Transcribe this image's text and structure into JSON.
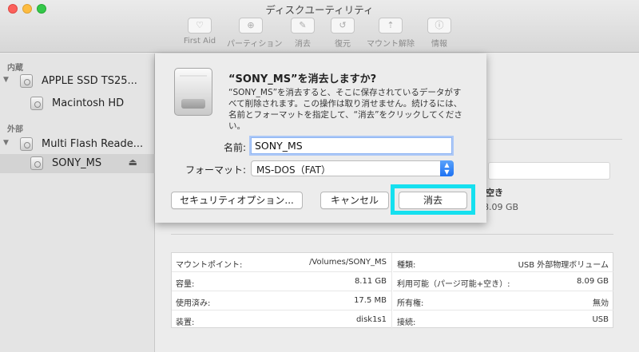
{
  "window": {
    "title": "ディスクユーティリティ"
  },
  "toolbar": {
    "buttons": [
      {
        "label": "First Aid",
        "icon": "stethoscope-icon"
      },
      {
        "label": "パーティション",
        "icon": "pie-icon"
      },
      {
        "label": "消去",
        "icon": "erase-icon"
      },
      {
        "label": "復元",
        "icon": "restore-icon"
      },
      {
        "label": "マウント解除",
        "icon": "unmount-icon"
      },
      {
        "label": "情報",
        "icon": "info-icon"
      }
    ]
  },
  "sidebar": {
    "internal_header": "内蔵",
    "external_header": "外部",
    "items": [
      {
        "label": "APPLE SSD TS25..."
      },
      {
        "label": "Macintosh HD"
      },
      {
        "label": "Multi Flash Reade..."
      },
      {
        "label": "SONY_MS"
      }
    ]
  },
  "dialog": {
    "title": "“SONY_MS”を消去しますか?",
    "description": "“SONY_MS”を消去すると、そこに保存されているデータがすべて削除されます。この操作は取り消せません。続けるには、名前とフォーマットを指定して、“消去”をクリックしてください。",
    "name_label": "名前:",
    "name_value": "SONY_MS",
    "format_label": "フォーマット:",
    "format_value": "MS-DOS（FAT）",
    "security_button": "セキュリティオプション...",
    "cancel_button": "キャンセル",
    "erase_button": "消去"
  },
  "summary": {
    "free_label": "空き",
    "free_value": "8.09 GB"
  },
  "info": {
    "left": [
      {
        "key": "マウントポイント:",
        "value": "/Volumes/SONY_MS"
      },
      {
        "key": "容量:",
        "value": "8.11 GB"
      },
      {
        "key": "使用済み:",
        "value": "17.5 MB"
      },
      {
        "key": "装置:",
        "value": "disk1s1"
      }
    ],
    "right": [
      {
        "key": "種類:",
        "value": "USB 外部物理ボリューム"
      },
      {
        "key": "利用可能（パージ可能+空き）:",
        "value": "8.09 GB"
      },
      {
        "key": "所有権:",
        "value": "無効"
      },
      {
        "key": "接続:",
        "value": "USB"
      }
    ]
  },
  "colors": {
    "highlight": "#15e0ef",
    "accent": "#1d72f3"
  }
}
